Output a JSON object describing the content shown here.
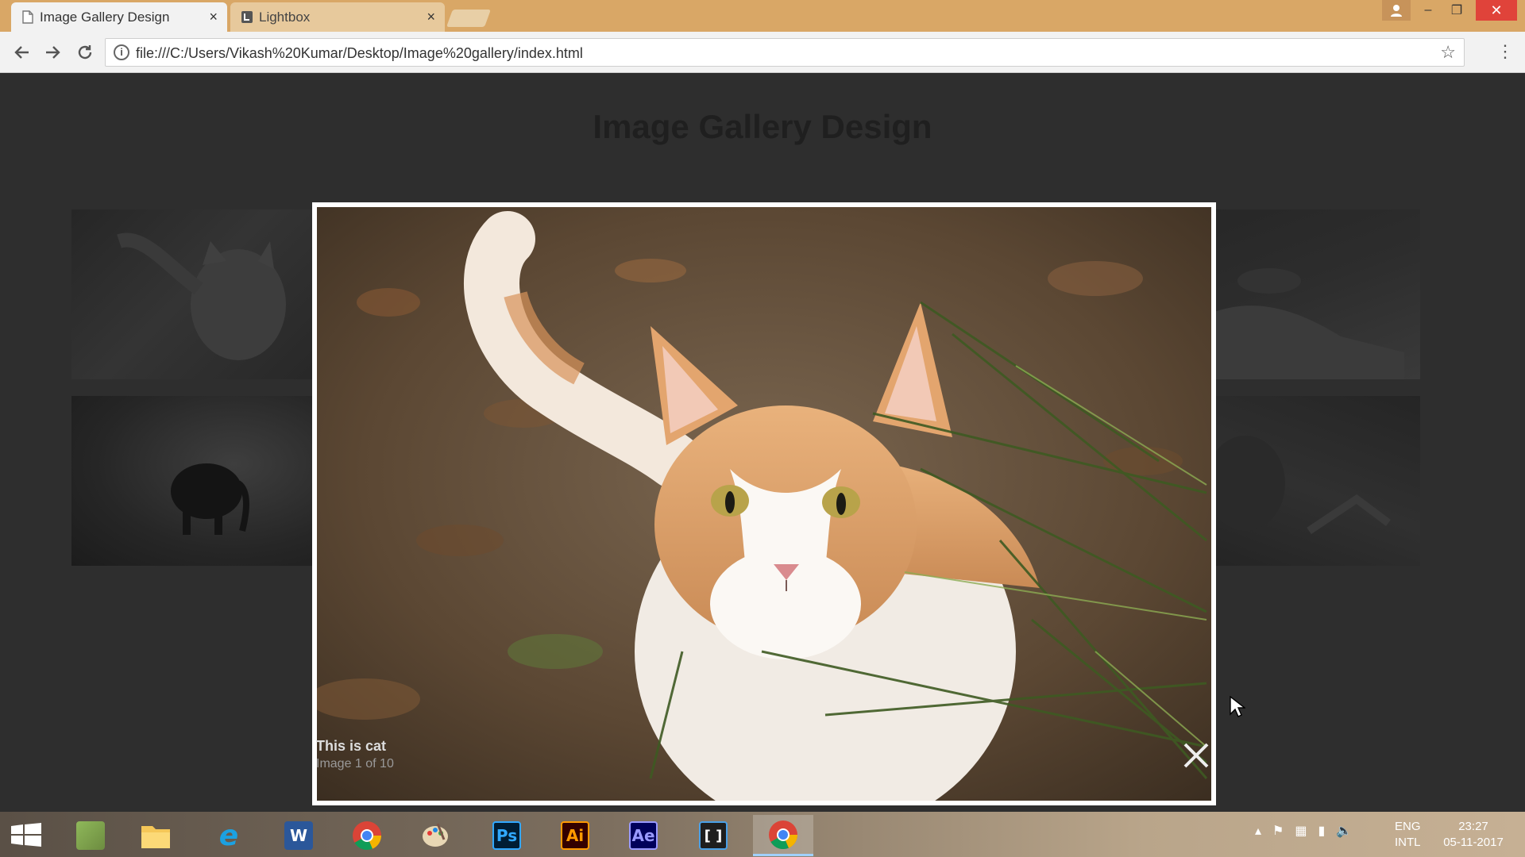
{
  "browser": {
    "tabs": [
      {
        "title": "Image Gallery Design",
        "active": true
      },
      {
        "title": "Lightbox",
        "active": false
      }
    ],
    "close_glyph": "×",
    "url": "file:///C:/Users/Vikash%20Kumar/Desktop/Image%20gallery/index.html",
    "window_controls": {
      "minimize": "–",
      "maximize": "❐",
      "close": "✕"
    }
  },
  "page": {
    "title": "Image Gallery Design"
  },
  "lightbox": {
    "caption": "This is cat",
    "counter": "Image 1 of 10"
  },
  "taskbar": {
    "apps": [
      {
        "icon": "minecraft-icon",
        "active": false
      },
      {
        "icon": "file-explorer-icon",
        "active": false
      },
      {
        "icon": "internet-explorer-icon",
        "label": "e",
        "color": "#1ba1e2",
        "active": false
      },
      {
        "icon": "word-icon",
        "label": "W",
        "color": "#2b579a",
        "active": false
      },
      {
        "icon": "chrome-icon",
        "active": false
      },
      {
        "icon": "paint-icon",
        "active": false
      },
      {
        "icon": "photoshop-icon",
        "label": "Ps",
        "color": "#001d34",
        "fg": "#31a8ff",
        "active": false
      },
      {
        "icon": "illustrator-icon",
        "label": "Ai",
        "color": "#330000",
        "fg": "#ff9a00",
        "active": false
      },
      {
        "icon": "after-effects-icon",
        "label": "Ae",
        "color": "#00005b",
        "fg": "#9999ff",
        "active": false
      },
      {
        "icon": "brackets-icon",
        "label": "[ ]",
        "color": "#1e1e1e",
        "fg": "#fff",
        "active": false
      },
      {
        "icon": "chrome-icon",
        "active": true
      }
    ],
    "language": {
      "line1": "ENG",
      "line2": "INTL"
    },
    "clock": {
      "time": "23:27",
      "date": "05-11-2017"
    }
  }
}
